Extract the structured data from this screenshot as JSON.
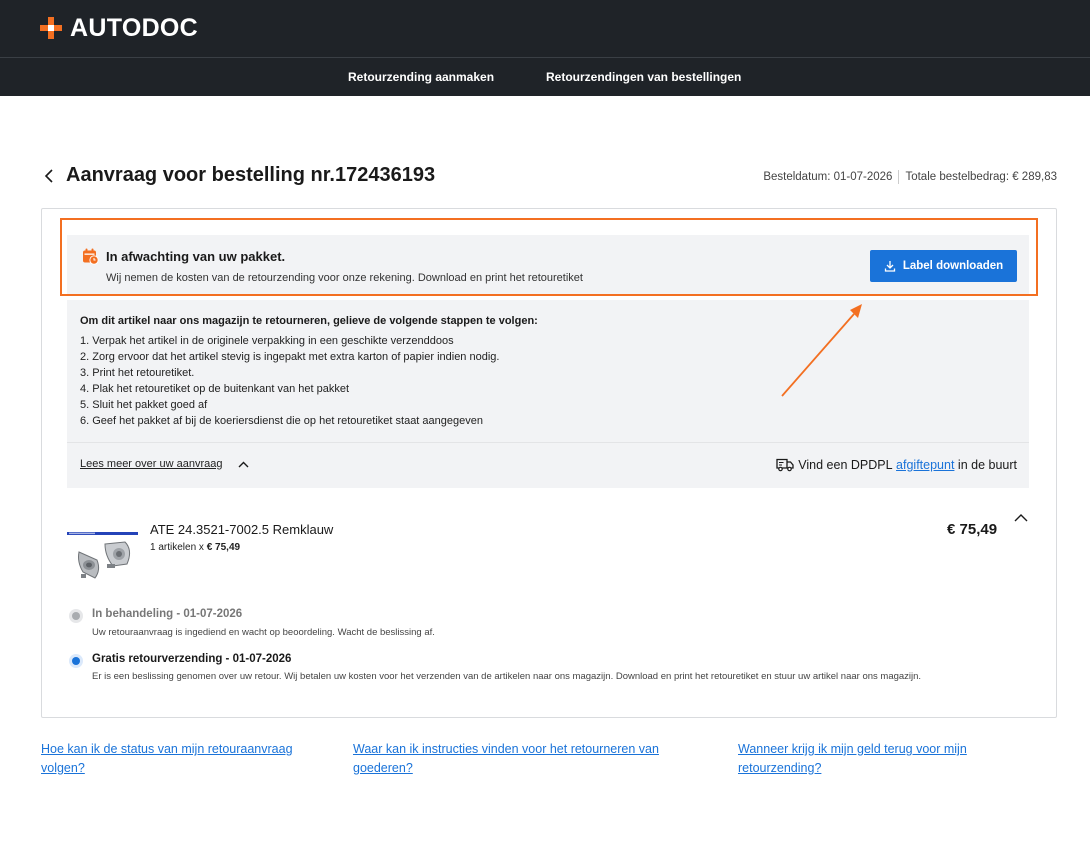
{
  "header": {
    "logo_text": "AUTODOC",
    "nav": [
      "Retourzending aanmaken",
      "Retourzendingen van bestellingen"
    ]
  },
  "page": {
    "title": "Aanvraag voor bestelling nr.172436193",
    "order_date": "Besteldatum: 01-07-2026",
    "order_total": "Totale bestelbedrag: € 289,83"
  },
  "status": {
    "title": "In afwachting van uw pakket.",
    "subtitle": "Wij nemen de kosten van de retourzending voor onze rekening. Download en print het retouretiket",
    "download_label": "Label downloaden"
  },
  "instructions": {
    "intro": "Om dit artikel naar ons magazijn te retourneren, gelieve de volgende stappen te volgen:",
    "steps": [
      "1. Verpak het artikel in de originele verpakking in een geschikte verzenddoos",
      "2. Zorg ervoor dat het artikel stevig is ingepakt met extra karton of papier indien nodig.",
      "3. Print het retouretiket.",
      "4. Plak het retouretiket op de buitenkant van het pakket",
      "5. Sluit het pakket goed af",
      "6. Geef het pakket af bij de koeriersdienst die op het retouretiket staat aangegeven"
    ],
    "read_more": "Lees meer over uw aanvraag",
    "dpd_prefix": "Vind een DPDPL",
    "dpd_link": "afgiftepunt",
    "dpd_suffix": "in de buurt"
  },
  "product": {
    "name": "ATE 24.3521-7002.5 Remklauw",
    "qty_text": "1 artikelen x",
    "unit_price": "€ 75,49",
    "price": "€ 75,49"
  },
  "timeline": [
    {
      "title": "In behandeling - 01-07-2026",
      "desc": "Uw retouraanvraag is ingediend en wacht op beoordeling. Wacht de beslissing af."
    },
    {
      "title": "Gratis retourverzending - 01-07-2026",
      "desc": "Er is een beslissing genomen over uw retour. Wij betalen uw kosten voor het verzenden van de artikelen naar ons magazijn. Download en print het retouretiket en stuur uw artikel naar ons magazijn."
    }
  ],
  "faq": [
    {
      "line1": "Hoe kan ik de status van mijn retouraanvraag",
      "line2": "volgen?"
    },
    {
      "line1": "Waar kan ik instructies vinden voor het retourneren van",
      "line2": "goederen?"
    },
    {
      "line1": "Wanneer krijg ik mijn geld terug voor mijn",
      "line2": "retourzending?"
    }
  ],
  "colors": {
    "header_bg": "#1f2328",
    "brand_orange": "#f36f21",
    "primary_blue": "#1a73d9",
    "panel_bg": "#f2f3f5"
  },
  "icons": [
    "calendar-clock-icon",
    "download-icon",
    "chevron-left-icon",
    "chevron-up-icon",
    "delivery-truck-icon",
    "annotation-arrow"
  ]
}
